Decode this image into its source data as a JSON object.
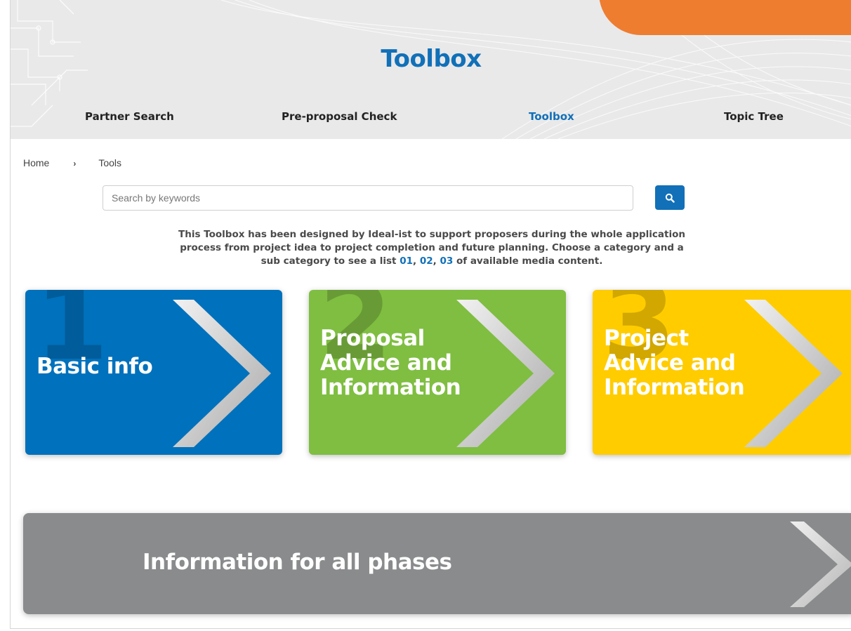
{
  "header": {
    "title": "Toolbox",
    "nav": [
      {
        "label": "Partner Search",
        "active": false
      },
      {
        "label": "Pre-proposal Check",
        "active": false
      },
      {
        "label": "Toolbox",
        "active": true
      },
      {
        "label": "Topic Tree",
        "active": false
      }
    ]
  },
  "breadcrumb": {
    "home": "Home",
    "separator": "›",
    "current": "Tools"
  },
  "search": {
    "placeholder": "Search by keywords",
    "value": "",
    "button_icon": "search-icon"
  },
  "intro": {
    "text_before": "This Toolbox has been designed by Ideal-ist to support proposers during the whole application process from project idea to project completion and future planning. Choose a category and a sub category to see a list ",
    "links": [
      "01",
      "02",
      "03"
    ],
    "text_after": " of available media content."
  },
  "categories": [
    {
      "number": "1",
      "title_lines": [
        "Basic info"
      ],
      "color": "#0071bc"
    },
    {
      "number": "2",
      "title_lines": [
        "Proposal",
        "Advice and",
        "Information"
      ],
      "color": "#7fbe41"
    },
    {
      "number": "3",
      "title_lines": [
        "Project",
        "Advice and",
        "Information"
      ],
      "color": "#ffcc00"
    }
  ],
  "all_phases": {
    "title": "Information for all phases",
    "color": "#898b8c"
  },
  "colors": {
    "accent_blue": "#1170b8",
    "orange": "#ee7d30"
  }
}
